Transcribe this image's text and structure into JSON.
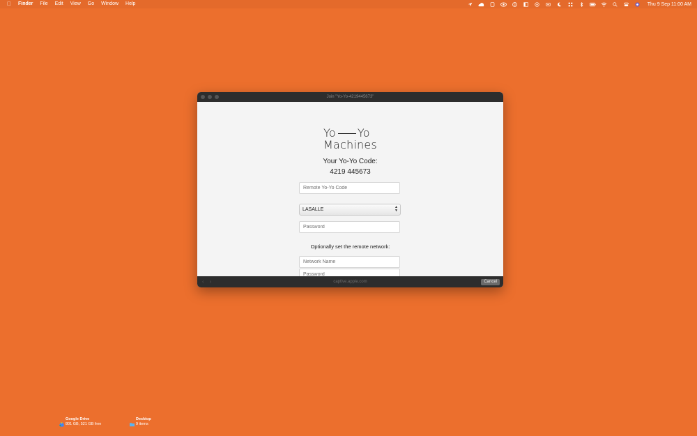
{
  "menubar": {
    "apple": "",
    "items": [
      "Finder",
      "File",
      "Edit",
      "View",
      "Go",
      "Window",
      "Help"
    ],
    "status_icons": [
      "location-icon",
      "cloud-icon",
      "app-icon",
      "eye-icon",
      "cc-icon",
      "sidebar-icon",
      "target-icon",
      "clock-icon",
      "moon-icon",
      "grid-icon",
      "bluetooth-icon",
      "battery-icon",
      "wifi-icon",
      "search-icon",
      "control-center-icon",
      "siri-icon"
    ],
    "battery_text": "",
    "clock": "Thu 9 Sep  11:00 AM"
  },
  "window": {
    "title": "Join \"Yo-Yo-4219445673\"",
    "logo_line1_left": "Yo",
    "logo_line1_right": "Yo",
    "logo_line2": "Machines",
    "code_label": "Your Yo-Yo Code:",
    "code_value": "4219 445673",
    "remote_code_placeholder": "Remote Yo-Yo Code",
    "network_select_value": "LASALLE",
    "password_placeholder": "Password",
    "optional_text": "Optionally set the remote network:",
    "network_name_placeholder": "Network Name",
    "network_password_placeholder": "Password",
    "footer_url": "captive.apple.com",
    "cancel_label": "Cancel"
  },
  "desktop": {
    "google_drive": {
      "name": "Google Drive",
      "info": "801 GB, 521 GB free"
    },
    "desktop_folder": {
      "name": "Desktop",
      "info": "9 items"
    }
  },
  "colors": {
    "wallpaper": "#ec6f2d",
    "window_chrome": "#2d2d2d",
    "window_content": "#f4f4f4"
  }
}
